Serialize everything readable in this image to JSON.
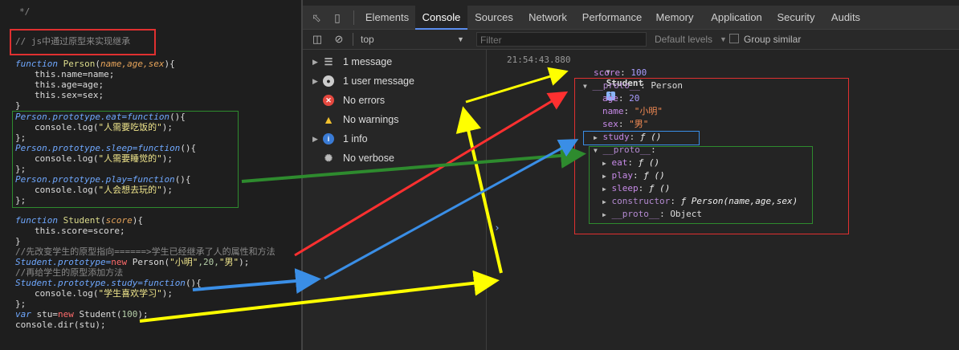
{
  "editor": {
    "top_comment": "*/",
    "heading_comment": "// js中通过原型来实现继承",
    "code": {
      "l1_kw": "function",
      "l1_name": "Person",
      "l1_params": "name,age,sex",
      "l1_end": "){",
      "l2": "this.name=name;",
      "l3": "this.age=age;",
      "l4": "this.sex=sex;",
      "l5": "}",
      "l6_obj": "Person.prototype.eat=",
      "l6_kw": "function",
      "l6_end": "(){",
      "l7_call": "console.log(",
      "l7_str": "\"人需要吃饭的\"",
      "l7_end": ");",
      "l8": "};",
      "l9_obj": "Person.prototype.sleep=",
      "l9_kw": "function",
      "l9_end": "(){",
      "l10_call": "console.log(",
      "l10_str": "\"人需要睡觉的\"",
      "l10_end": ");",
      "l11": "};",
      "l12_obj": "Person.prototype.play=",
      "l12_kw": "function",
      "l12_end": "(){",
      "l13_call": "console.log(",
      "l13_str": "\"人会想去玩的\"",
      "l13_end": ");",
      "l14": "};",
      "l15_kw": "function",
      "l15_name": "Student",
      "l15_params": "score",
      "l15_end": "){",
      "l16": "this.score=score;",
      "l17": "}",
      "l18": "//先改变学生的原型指向======>学生已经继承了人的属性和方法",
      "l19_obj": "Student.prototype=",
      "l19_kw": "new",
      "l19_rest": " Person(",
      "l19_s1": "\"小明\"",
      "l19_n": ",20,",
      "l19_s2": "\"男\"",
      "l19_end": ");",
      "l20": "//再给学生的原型添加方法",
      "l21_obj": "Student.prototype.study=",
      "l21_kw": "function",
      "l21_end": "(){",
      "l22_call": "console.log(",
      "l22_str": "\"学生喜欢学习\"",
      "l22_end": ");",
      "l23": "};",
      "l24_kw": "var",
      "l24_rest": " stu=",
      "l24_kw2": "new",
      "l24_rest2": " Student(",
      "l24_num": "100",
      "l24_end": ");",
      "l25": "console.dir(stu);"
    }
  },
  "devtools": {
    "tabs": [
      "Elements",
      "Console",
      "Sources",
      "Network",
      "Performance",
      "Memory",
      "Application",
      "Security",
      "Audits"
    ],
    "active_tab": "Console",
    "toolbar": {
      "context": "top",
      "filter_placeholder": "Filter",
      "levels": "Default levels",
      "group_similar": "Group similar"
    },
    "sidebar": [
      {
        "label": "1 message",
        "icon": "list-icon"
      },
      {
        "label": "1 user message",
        "icon": "user-icon"
      },
      {
        "label": "No errors",
        "icon": "error-icon"
      },
      {
        "label": "No warnings",
        "icon": "warning-icon"
      },
      {
        "label": "1 info",
        "icon": "info-icon"
      },
      {
        "label": "No verbose",
        "icon": "bug-icon"
      }
    ],
    "console": {
      "timestamp": "21:54:43.880",
      "object_name": "Student",
      "score_key": "score",
      "score_val": "100",
      "proto1_key": "__proto__",
      "proto1_val": "Person",
      "age_key": "age",
      "age_val": "20",
      "name_key": "name",
      "name_val": "\"小明\"",
      "sex_key": "sex",
      "sex_val": "\"男\"",
      "study_key": "study",
      "study_val": "ƒ ()",
      "proto2_key": "__proto__",
      "proto2_val": "",
      "eat_key": "eat",
      "eat_val": "ƒ ()",
      "play_key": "play",
      "play_val": "ƒ ()",
      "sleep_key": "sleep",
      "sleep_val": "ƒ ()",
      "constructor_key": "constructor",
      "constructor_val": "ƒ Person(name,age,sex)",
      "proto3_key": "__proto__",
      "proto3_val": "Object",
      "prompt": "›"
    }
  },
  "colors": {
    "highlight_red": "#e03030",
    "highlight_green": "#2e8b2e",
    "highlight_blue": "#3a8ee6",
    "arrow_yellow": "#ffff00",
    "arrow_red": "#ff3030",
    "arrow_green": "#2e8b2e",
    "arrow_blue": "#3a8ee6"
  }
}
